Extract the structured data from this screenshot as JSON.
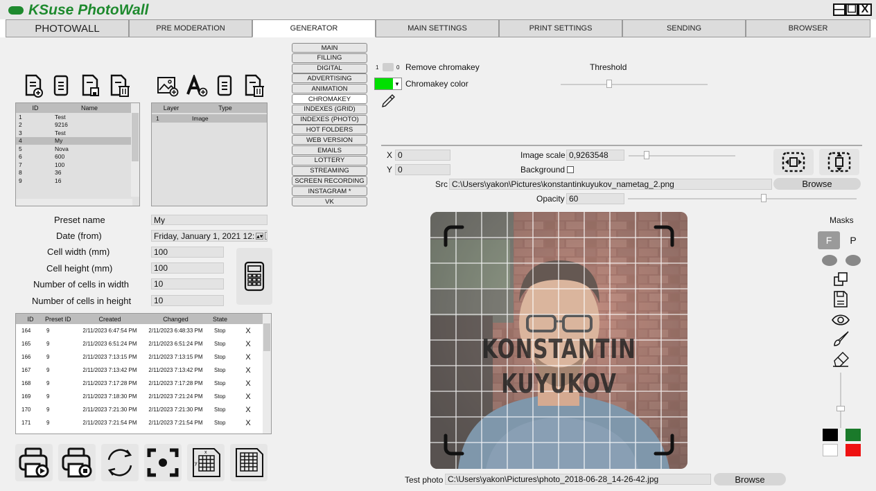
{
  "app": {
    "title": "KSuse PhotoWall",
    "win_min": "—",
    "win_max": "☐",
    "win_close": "X"
  },
  "tabs": [
    {
      "label": "PHOTOWALL"
    },
    {
      "label": "PRE MODERATION"
    },
    {
      "label": "GENERATOR"
    },
    {
      "label": "MAIN SETTINGS"
    },
    {
      "label": "PRINT SETTINGS"
    },
    {
      "label": "SENDING"
    },
    {
      "label": "BROWSER"
    }
  ],
  "subnav": [
    {
      "label": "MAIN"
    },
    {
      "label": "FILLING"
    },
    {
      "label": "DIGITAL"
    },
    {
      "label": "ADVERTISING"
    },
    {
      "label": "ANIMATION"
    },
    {
      "label": "CHROMAKEY"
    },
    {
      "label": "INDEXES (GRID)"
    },
    {
      "label": "INDEXES (PHOTO)"
    },
    {
      "label": "HOT FOLDERS"
    },
    {
      "label": "WEB VERSION"
    },
    {
      "label": "EMAILS"
    },
    {
      "label": "LOTTERY"
    },
    {
      "label": "STREAMING"
    },
    {
      "label": "SCREEN RECORDING"
    },
    {
      "label": "INSTAGRAM *"
    },
    {
      "label": "VK"
    }
  ],
  "presets": {
    "headers": {
      "id": "ID",
      "name": "Name"
    },
    "rows": [
      {
        "id": "1",
        "name": "Test"
      },
      {
        "id": "2",
        "name": "9216"
      },
      {
        "id": "3",
        "name": "Test"
      },
      {
        "id": "4",
        "name": "My"
      },
      {
        "id": "5",
        "name": "Nova"
      },
      {
        "id": "6",
        "name": "600"
      },
      {
        "id": "7",
        "name": "100"
      },
      {
        "id": "8",
        "name": "36"
      },
      {
        "id": "9",
        "name": "16"
      }
    ],
    "selected_index": 3
  },
  "layers": {
    "headers": {
      "layer": "Layer",
      "type": "Type"
    },
    "rows": [
      {
        "layer": "1",
        "type": "Image"
      }
    ]
  },
  "form": {
    "preset_name_label": "Preset name",
    "preset_name": "My",
    "date_label": "Date (from)",
    "date": "Friday, January 1, 2021 12:",
    "cell_width_label": "Cell width (mm)",
    "cell_width": "100",
    "cell_height_label": "Cell height (mm)",
    "cell_height": "100",
    "cells_w_label": "Number of cells in width",
    "cells_w": "10",
    "cells_h_label": "Number of cells in height",
    "cells_h": "10"
  },
  "sessions": {
    "headers": {
      "id": "ID",
      "preset": "Preset ID",
      "created": "Created",
      "changed": "Changed",
      "state": "State"
    },
    "rows": [
      {
        "id": "164",
        "preset": "9",
        "created": "2/11/2023 6:47:54 PM",
        "changed": "2/11/2023 6:48:33 PM",
        "state": "Stop",
        "x": "X"
      },
      {
        "id": "165",
        "preset": "9",
        "created": "2/11/2023 6:51:24 PM",
        "changed": "2/11/2023 6:51:24 PM",
        "state": "Stop",
        "x": "X"
      },
      {
        "id": "166",
        "preset": "9",
        "created": "2/11/2023 7:13:15 PM",
        "changed": "2/11/2023 7:13:15 PM",
        "state": "Stop",
        "x": "X"
      },
      {
        "id": "167",
        "preset": "9",
        "created": "2/11/2023 7:13:42 PM",
        "changed": "2/11/2023 7:13:42 PM",
        "state": "Stop",
        "x": "X"
      },
      {
        "id": "168",
        "preset": "9",
        "created": "2/11/2023 7:17:28 PM",
        "changed": "2/11/2023 7:17:28 PM",
        "state": "Stop",
        "x": "X"
      },
      {
        "id": "169",
        "preset": "9",
        "created": "2/11/2023 7:18:30 PM",
        "changed": "2/11/2023 7:21:24 PM",
        "state": "Stop",
        "x": "X"
      },
      {
        "id": "170",
        "preset": "9",
        "created": "2/11/2023 7:21:30 PM",
        "changed": "2/11/2023 7:21:30 PM",
        "state": "Stop",
        "x": "X"
      },
      {
        "id": "171",
        "preset": "9",
        "created": "2/11/2023 7:21:54 PM",
        "changed": "2/11/2023 7:21:54 PM",
        "state": "Stop",
        "x": "X"
      }
    ]
  },
  "chromakey": {
    "toggle_off": "1",
    "toggle_on": "0",
    "remove_label": "Remove chromakey",
    "threshold_label": "Threshold",
    "color_label": "Chromakey color",
    "color": "#00e000"
  },
  "image": {
    "x_label": "X",
    "x": "0",
    "y_label": "Y",
    "y": "0",
    "scale_label": "Image scale",
    "scale": "0,9263548",
    "background_label": "Background",
    "src_label": "Src",
    "src": "C:\\Users\\yakon\\Pictures\\konstantinkuyukov_nametag_2.png",
    "browse": "Browse",
    "opacity_label": "Opacity",
    "opacity": "60"
  },
  "preview": {
    "line1": "KONSTANTIN",
    "line2": "KUYUKOV"
  },
  "test_photo": {
    "label": "Test photo",
    "path": "C:\\Users\\yakon\\Pictures\\photo_2018-06-28_14-26-42.jpg",
    "browse": "Browse"
  },
  "masks": {
    "label": "Masks",
    "f": "F",
    "p": "P",
    "colors": [
      "#000000",
      "#1a7a2a",
      "#ffffff",
      "#ee1111"
    ]
  }
}
